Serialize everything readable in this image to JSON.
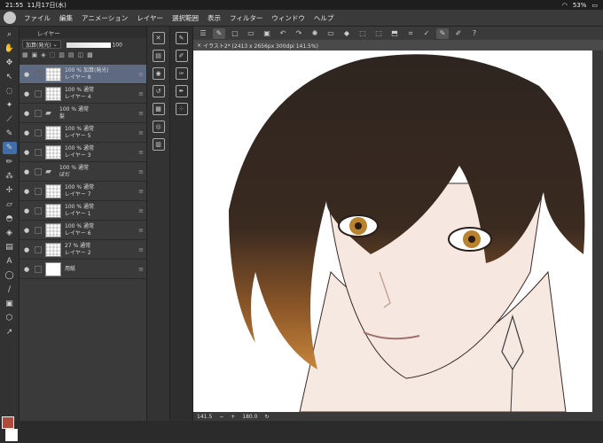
{
  "status": {
    "time": "21:55",
    "date": "11月17日(水)",
    "battery": "53%"
  },
  "menu": [
    "ファイル",
    "編集",
    "アニメーション",
    "レイヤー",
    "選択範囲",
    "表示",
    "フィルター",
    "ウィンドウ",
    "ヘルプ"
  ],
  "layer_panel": {
    "title": "レイヤー",
    "blend_mode": "加算(発光)",
    "opacity": "100",
    "layers": [
      {
        "line1": "100 % 加算(発光)",
        "line2": "レイヤー 8",
        "type": "layer",
        "selected": true
      },
      {
        "line1": "100 % 通常",
        "line2": "レイヤー 4",
        "type": "layer"
      },
      {
        "line1": "100 % 通常",
        "line2": "髪",
        "type": "folder"
      },
      {
        "line1": "100 % 通常",
        "line2": "レイヤー 5",
        "type": "layer"
      },
      {
        "line1": "100 % 通常",
        "line2": "レイヤー 3",
        "type": "layer"
      },
      {
        "line1": "100 % 通常",
        "line2": "ぼだ",
        "type": "folder"
      },
      {
        "line1": "100 % 通常",
        "line2": "レイヤー 7",
        "type": "layer"
      },
      {
        "line1": "100 % 通常",
        "line2": "レイヤー 1",
        "type": "layer"
      },
      {
        "line1": "100 % 通常",
        "line2": "レイヤー 6",
        "type": "layer"
      },
      {
        "line1": "27 % 通常",
        "line2": "レイヤー 2",
        "type": "layer"
      },
      {
        "line1": "",
        "line2": "用紙",
        "type": "paper"
      }
    ]
  },
  "canvas_tab": "イラスト2* (2413 x 2656px 300dpi 141.5%)",
  "bottom_bar": {
    "zoom": "141.5",
    "angle": "180.0"
  },
  "colors": {
    "main": "#b04a3a",
    "accent": "#3f6ea8"
  }
}
